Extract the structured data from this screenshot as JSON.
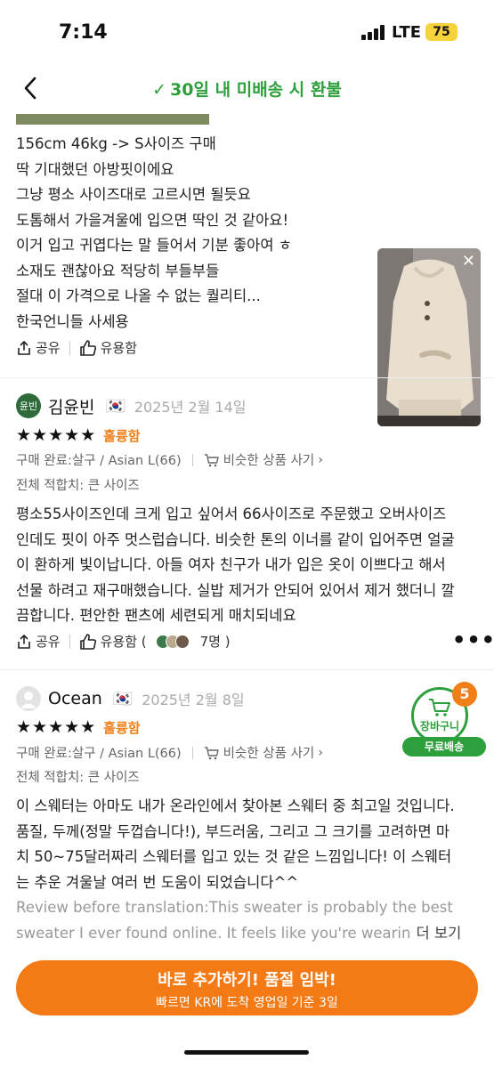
{
  "status": {
    "time": "7:14",
    "network": "LTE",
    "battery": "75"
  },
  "header": {
    "title": "30일 내 미배송 시 환불"
  },
  "review1": {
    "lines": [
      "156cm 46kg -> S사이즈 구매",
      "딱 기대했던 아방핏이에요",
      "그냥 평소 사이즈대로 고르시면 될듯요",
      "도톰해서 가을겨울에 입으면 딱인 것 같아요!",
      "이거 입고 귀엽다는 말 들어서 기분 좋아여 ㅎ",
      "소재도 괜찮아요 적당히 부들부들",
      "절대 이 가격으로 나올 수 없는 퀄리티...",
      "한국언니들 사세용"
    ],
    "share": "공유",
    "helpful": "유용함"
  },
  "review2": {
    "avatar_text": "윤빈",
    "name": "김윤빈",
    "flag": "🇰🇷",
    "date": "2025년 2월 14일",
    "stars": "★★★★★",
    "grade": "훌륭함",
    "purchase": "구매 완료:살구 / Asian L(66)",
    "similar": "비슷한 상품 사기",
    "fit": "전체 적합치: 큰 사이즈",
    "lines": [
      "평소55사이즈인데 크게 입고 싶어서 66사이즈로 주문했고 오버사이즈",
      "인데도 핏이 아주 멋스럽습니다. 비슷한 톤의 이너를 같이 입어주면 얼굴",
      "이 환하게 빛이납니다. 아들 여자 친구가 내가 입은 옷이 이쁘다고 해서",
      "선물 하려고 재구매했습니다. 실밥 제거가 안되어 있어서 제거 했더니 깔",
      "끔합니다. 편안한 팬츠에 세련되게 매치되네요"
    ],
    "share": "공유",
    "helpful": "유용함 (",
    "helpful_count": "7명 )"
  },
  "review3": {
    "name": "Ocean",
    "flag": "🇰🇷",
    "date": "2025년 2월 8일",
    "stars": "★★★★★",
    "grade": "훌륭함",
    "purchase": "구매 완료:살구 / Asian L(66)",
    "similar": "비슷한 상품 사기",
    "fit": "전체 적합치: 큰 사이즈",
    "lines": [
      "이 스웨터는 아마도 내가 온라인에서 찾아본 스웨터 중 최고일 것입니다.",
      "품질, 두께(정말 두껍습니다!), 부드러움, 그리고 그 크기를 고려하면 마",
      "치 50~75달러짜리 스웨터를 입고 있는 것 같은 느낌입니다! 이 스웨터",
      "는 추운 겨울날 여러 번 도움이 되었습니다^^"
    ],
    "translated_lines": [
      "Review before translation:This sweater is probably the best",
      "sweater I ever found online. It feels like you're wearin"
    ],
    "more": "더 보기"
  },
  "cart": {
    "badge": "5",
    "label": "장바구니",
    "free_shipping": "무료배송"
  },
  "cta": {
    "main": "바로 추가하기! 품절 임박!",
    "sub": "빠르면 KR에 도착 영업일 기준 3일"
  },
  "colors": {
    "brand_green": "#2d9f3c",
    "accent_orange": "#f47a15"
  }
}
